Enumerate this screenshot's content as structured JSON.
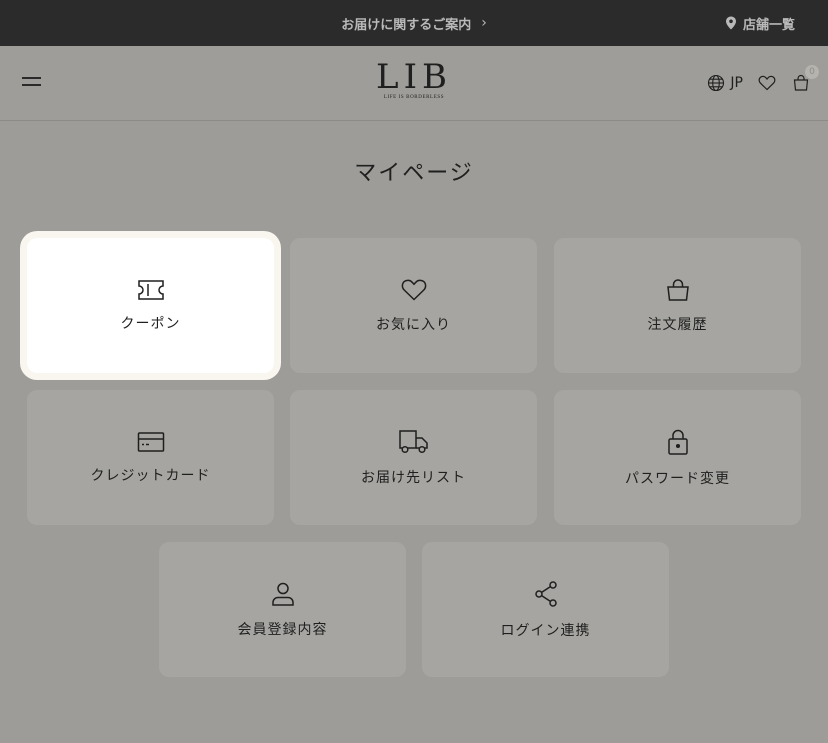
{
  "topbar": {
    "notice": "お届けに関するご案内",
    "notice_chevron": "›",
    "stores": "店舗一覧"
  },
  "header": {
    "logo": "LIB",
    "logo_tagline": "LIFE IS BORDERLESS",
    "language": "JP",
    "cart_count": "0"
  },
  "page": {
    "title": "マイページ"
  },
  "tiles": [
    {
      "label": "クーポン",
      "icon": "coupon-icon",
      "active": true
    },
    {
      "label": "お気に入り",
      "icon": "heart-icon"
    },
    {
      "label": "注文履歴",
      "icon": "shopping-bag-icon"
    },
    {
      "label": "クレジットカード",
      "icon": "credit-card-icon"
    },
    {
      "label": "お届け先リスト",
      "icon": "delivery-truck-icon"
    },
    {
      "label": "パスワード変更",
      "icon": "lock-icon"
    },
    {
      "label": "会員登録内容",
      "icon": "user-icon"
    },
    {
      "label": "ログイン連携",
      "icon": "share-icon"
    }
  ],
  "colors": {
    "topbar_bg": "#2b2b2b",
    "overlay_bg": "#9d9c98",
    "tile_bg": "#a6a5a1",
    "active_tile_bg": "#ffffff"
  }
}
